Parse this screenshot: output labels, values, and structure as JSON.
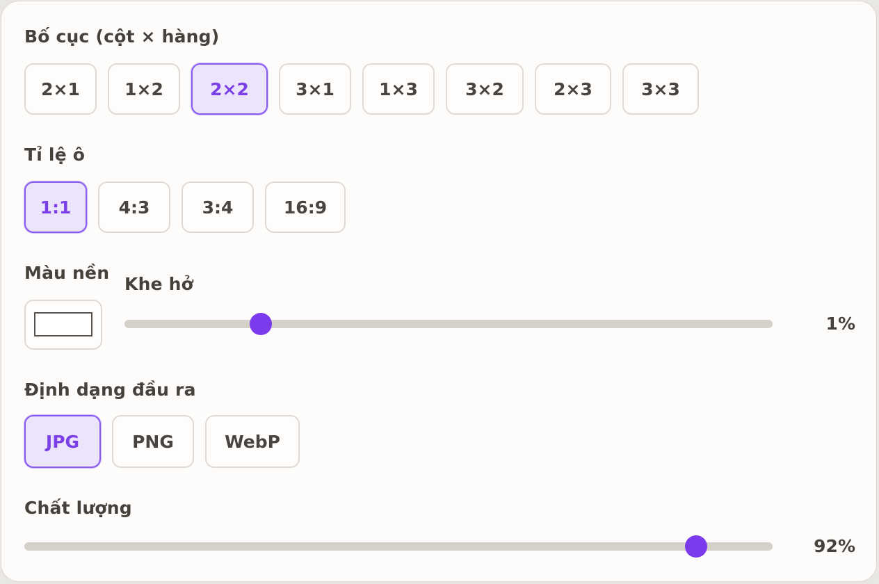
{
  "layout_section": {
    "label": "Bố cục (cột × hàng)",
    "options": [
      "2×1",
      "1×2",
      "2×2",
      "3×1",
      "1×3",
      "3×2",
      "2×3",
      "3×3"
    ],
    "selected": "2×2"
  },
  "ratio_section": {
    "label": "Tỉ lệ ô",
    "options": [
      "1:1",
      "4:3",
      "3:4",
      "16:9"
    ],
    "selected": "1:1"
  },
  "background": {
    "label": "Màu nền",
    "color": "#ffffff"
  },
  "gap": {
    "label": "Khe hở",
    "value": 1,
    "value_text": "1%"
  },
  "format_section": {
    "label": "Định dạng đầu ra",
    "options": [
      "JPG",
      "PNG",
      "WebP"
    ],
    "selected": "JPG"
  },
  "quality": {
    "label": "Chất lượng",
    "value": 92,
    "value_text": "92%"
  },
  "colors": {
    "accent": "#7c3aed",
    "selected_bg": "#ebe4fb",
    "track": "#d4d1cb"
  }
}
